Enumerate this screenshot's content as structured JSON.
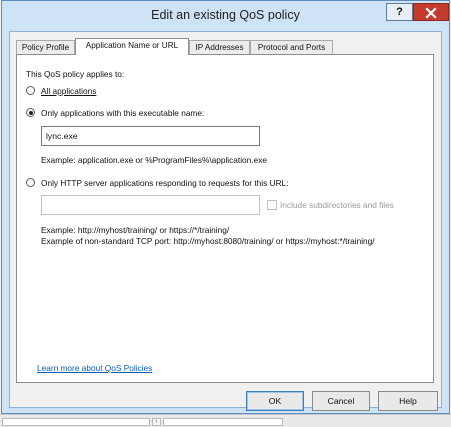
{
  "window": {
    "title": "Edit an existing QoS policy",
    "help_caption": "?",
    "close_caption": "x"
  },
  "tabs": [
    {
      "label": "Policy Profile",
      "active": false
    },
    {
      "label": "Application Name or URL",
      "active": true
    },
    {
      "label": "IP Addresses",
      "active": false
    },
    {
      "label": "Protocol and Ports",
      "active": false
    }
  ],
  "panel": {
    "applies_to_label": "This QoS policy applies to:",
    "option_all": "All applications",
    "option_exec": "Only applications with this executable name:",
    "exec_value": "lync.exe",
    "exec_example": "Example:  application.exe or %ProgramFiles%\\application.exe",
    "option_http": "Only HTTP server applications responding to requests for this URL:",
    "url_value": "",
    "include_subdirs": "Include subdirectories and files",
    "url_example1": "Example:  http://myhost/training/ or https://*/training/",
    "url_example2": "Example of non-standard TCP port:  http://myhost:8080/training/ or https://myhost:*/training/",
    "learn_more": "Learn more about QoS Policies",
    "selected_option": "exec"
  },
  "buttons": {
    "ok": "OK",
    "cancel": "Cancel",
    "help": "Help"
  }
}
